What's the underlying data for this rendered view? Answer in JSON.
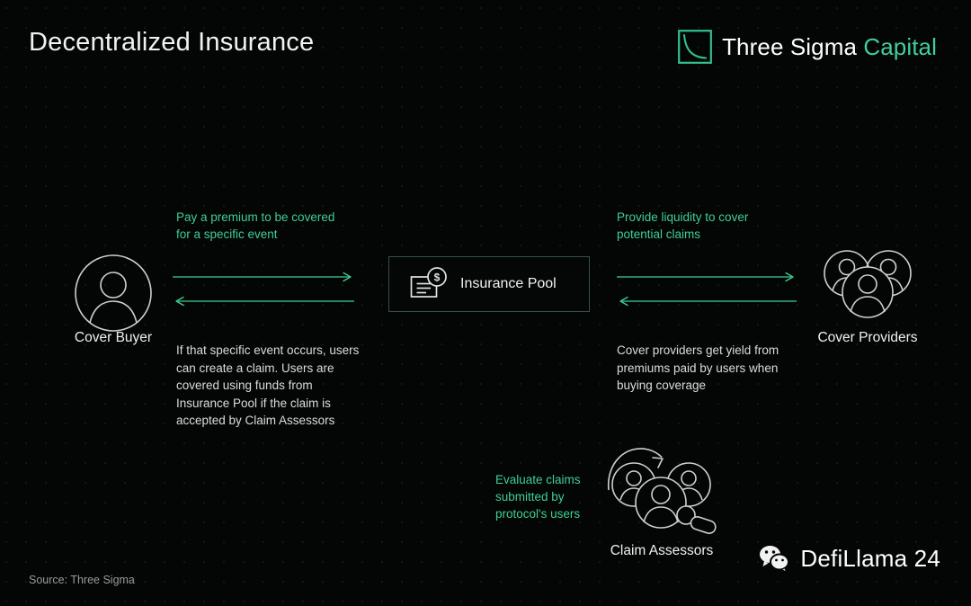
{
  "slide": {
    "title": "Decentralized Insurance",
    "source": "Source: Three Sigma",
    "background_color": "#040505",
    "accent_green": "#3fcf95"
  },
  "logo": {
    "mark_name": "three-sigma-decay-curve-mark",
    "name_primary": "Three Sigma",
    "name_secondary": "Capital"
  },
  "nodes": {
    "cover_buyer": {
      "label": "Cover Buyer",
      "icon": "single-person-circle-icon"
    },
    "insurance_pool": {
      "label": "Insurance Pool",
      "icon": "receipt-dollar-icon"
    },
    "cover_providers": {
      "label": "Cover Providers",
      "icon": "three-people-group-icon"
    },
    "claim_assessors": {
      "label": "Claim Assessors",
      "icon": "people-review-magnifier-icon"
    }
  },
  "annotations": {
    "buyer_to_pool": "Pay a premium to be covered\nfor a specific event",
    "buyer_to_pool_line1": "Pay a premium to be covered",
    "buyer_to_pool_line2": "for a specific event",
    "pool_to_buyer": "If that specific event occurs, users can create a claim. Users are covered using funds from Insurance Pool if the claim is accepted by Claim Assessors",
    "providers_to_pool_line1": "Provide liquidity to cover",
    "providers_to_pool_line2": "potential claims",
    "pool_to_providers": "Cover providers get yield from premiums paid by users when buying coverage",
    "assessors_line1": "Evaluate claims",
    "assessors_line2": "submitted by",
    "assessors_line3": "protocol's users"
  },
  "arrows": [
    {
      "name": "buyer-to-pool-arrow",
      "direction": "right"
    },
    {
      "name": "pool-to-buyer-arrow",
      "direction": "left"
    },
    {
      "name": "providers-to-pool-arrow",
      "direction": "right"
    },
    {
      "name": "pool-to-providers-arrow",
      "direction": "left"
    }
  ],
  "watermark": {
    "icon": "wechat-icon",
    "text": "DefiLlama 24"
  }
}
